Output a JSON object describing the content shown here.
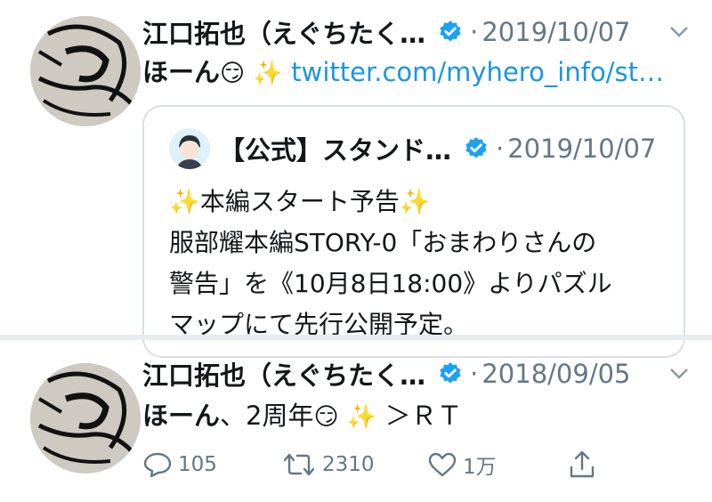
{
  "tweets": [
    {
      "author": "江口拓也（えぐちたく…",
      "date": "2019/10/07",
      "text_bold": "ほーん",
      "emoji1": "😏",
      "emoji2": "✨",
      "link": "twitter.com/myhero_info/st…",
      "quote": {
        "author": "【公式】スタンド…",
        "date": "2019/10/07",
        "lines": [
          "✨本編スタート予告✨",
          "服部耀本編STORY-0「おまわりさんの",
          "警告」を《10月8日18:00》よりパズル",
          "マップにて先行公開予定。"
        ]
      }
    },
    {
      "author": "江口拓也（えぐちたく…",
      "date": "2018/09/05",
      "text_bold": "ほーん",
      "text_rest": "、2周年",
      "emoji1": "😏",
      "emoji2": "✨",
      "text_tail": " ＞ＲＴ",
      "actions": {
        "replies": "105",
        "retweets": "2310",
        "likes": "1万"
      }
    }
  ],
  "dot": "·",
  "colors": {
    "link": "#1b95e0",
    "verified": "#1da1f2",
    "muted": "#657786"
  }
}
